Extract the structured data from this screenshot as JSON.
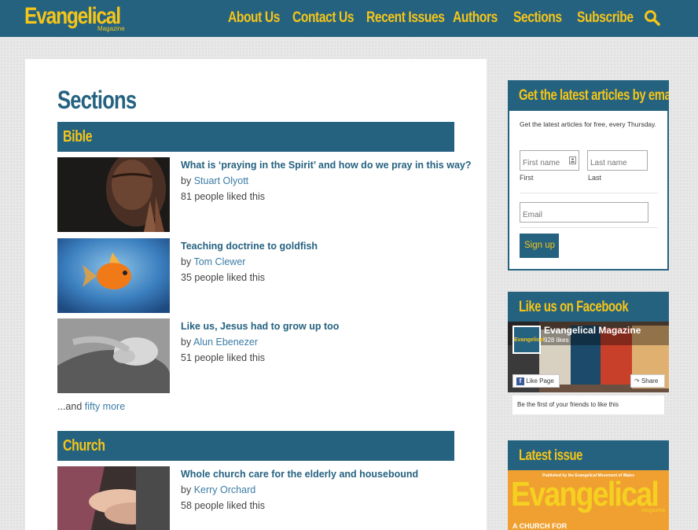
{
  "header": {
    "logo": "Evangelical",
    "logo_sub": "Magazine",
    "nav": [
      "About Us",
      "Contact Us",
      "Recent Issues",
      "Authors",
      "Sections",
      "Subscribe"
    ]
  },
  "main": {
    "title": "Sections",
    "sections": [
      {
        "name": "Bible",
        "articles": [
          {
            "title": "What is ‘praying in the Spirit’ and how do we pray in this way?",
            "by": "by",
            "author": "Stuart Olyott",
            "likes": "81 people liked this"
          },
          {
            "title": "Teaching doctrine to goldfish",
            "by": "by",
            "author": "Tom Clewer",
            "likes": "35 people liked this"
          },
          {
            "title": "Like us, Jesus had to grow up too",
            "by": "by",
            "author": "Alun Ebenezer",
            "likes": "51 people liked this"
          }
        ],
        "more_prefix": "...and",
        "more_link": "fifty more"
      },
      {
        "name": "Church",
        "articles": [
          {
            "title": "Whole church care for the elderly and housebound",
            "by": "by",
            "author": "Kerry Orchard",
            "likes": "58 people liked this"
          }
        ]
      }
    ]
  },
  "sidebar": {
    "email": {
      "title": "Get the latest articles by email",
      "desc": "Get the latest articles for free, every Thursday.",
      "first_placeholder": "First name",
      "last_placeholder": "Last name",
      "first_label": "First",
      "last_label": "Last",
      "email_placeholder": "Email",
      "button": "Sign up"
    },
    "facebook": {
      "title": "Like us on Facebook",
      "page_name": "Evangelical Magazine",
      "likes": "928 likes",
      "like_button": "Like Page",
      "share_button": "Share",
      "footer": "Be the first of your friends to like this"
    },
    "latest": {
      "title": "Latest issue",
      "cover_small": "Published by the Evangelical Movement of Wales",
      "cover_title": "Evangelical",
      "cover_sub": "Magazine",
      "cover_tagline": "A CHURCH FOR"
    }
  },
  "colors": {
    "brand": "#256280",
    "accent": "#f5c518"
  }
}
